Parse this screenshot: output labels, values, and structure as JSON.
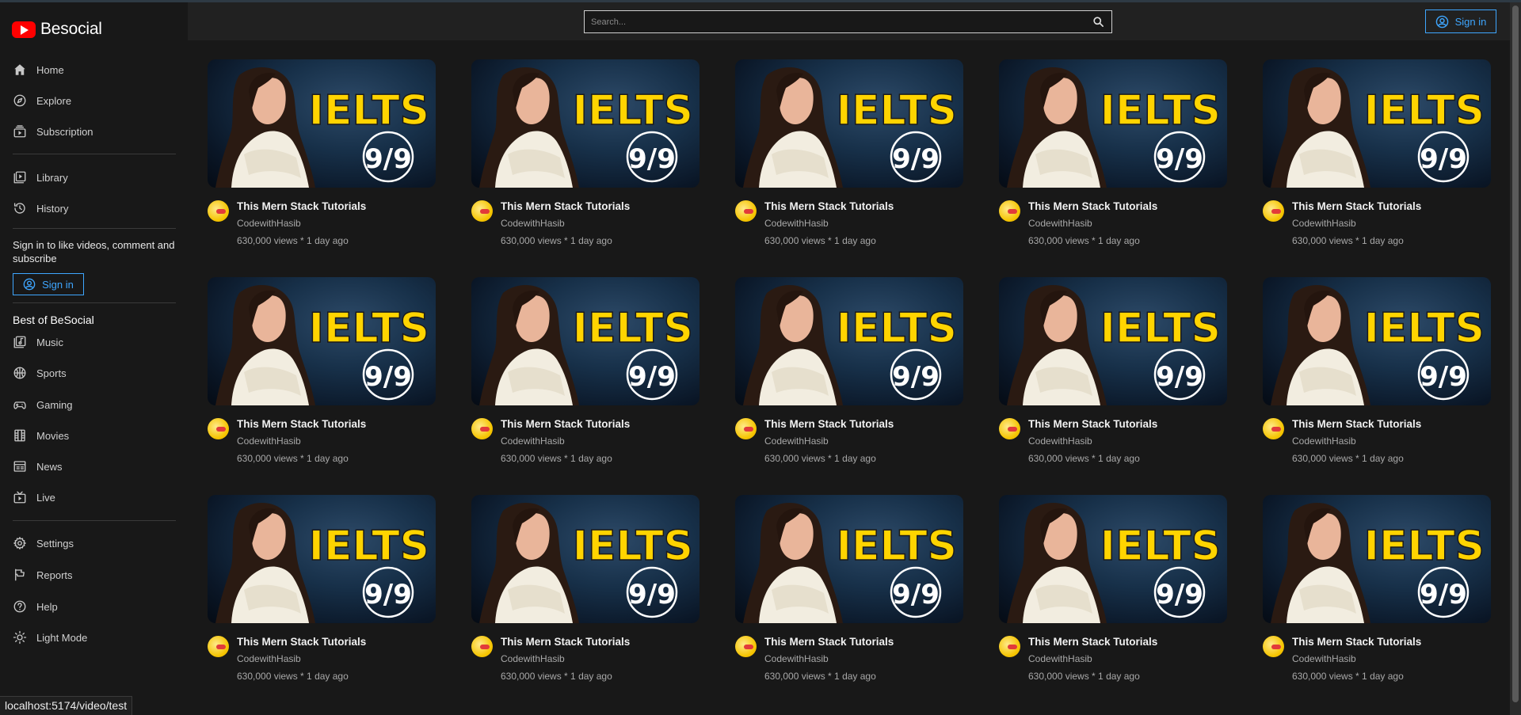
{
  "app": {
    "name": "Besocial"
  },
  "search": {
    "placeholder": "Search..."
  },
  "header": {
    "signin_label": "Sign in"
  },
  "sidebar": {
    "main": [
      {
        "label": "Home",
        "icon": "home-icon"
      },
      {
        "label": "Explore",
        "icon": "compass-icon"
      },
      {
        "label": "Subscription",
        "icon": "subscriptions-icon"
      }
    ],
    "library": [
      {
        "label": "Library",
        "icon": "library-icon"
      },
      {
        "label": "History",
        "icon": "history-icon"
      }
    ],
    "signin_prompt": "Sign in to like videos, comment and subscribe",
    "signin_label": "Sign in",
    "best_title": "Best of BeSocial",
    "best": [
      {
        "label": "Music",
        "icon": "music-icon"
      },
      {
        "label": "Sports",
        "icon": "sports-icon"
      },
      {
        "label": "Gaming",
        "icon": "gaming-icon"
      },
      {
        "label": "Movies",
        "icon": "movies-icon"
      },
      {
        "label": "News",
        "icon": "news-icon"
      },
      {
        "label": "Live",
        "icon": "live-icon"
      }
    ],
    "bottom": [
      {
        "label": "Settings",
        "icon": "gear-icon"
      },
      {
        "label": "Reports",
        "icon": "flag-icon"
      },
      {
        "label": "Help",
        "icon": "help-icon"
      },
      {
        "label": "Light Mode",
        "icon": "sun-icon"
      }
    ]
  },
  "thumbnail": {
    "text_main": "IELTS",
    "text_score": "9/9"
  },
  "videos": [
    {
      "title": "This Mern Stack Tutorials",
      "channel": "CodewithHasib",
      "stats": "630,000 views * 1 day ago"
    },
    {
      "title": "This Mern Stack Tutorials",
      "channel": "CodewithHasib",
      "stats": "630,000 views * 1 day ago"
    },
    {
      "title": "This Mern Stack Tutorials",
      "channel": "CodewithHasib",
      "stats": "630,000 views * 1 day ago"
    },
    {
      "title": "This Mern Stack Tutorials",
      "channel": "CodewithHasib",
      "stats": "630,000 views * 1 day ago"
    },
    {
      "title": "This Mern Stack Tutorials",
      "channel": "CodewithHasib",
      "stats": "630,000 views * 1 day ago"
    },
    {
      "title": "This Mern Stack Tutorials",
      "channel": "CodewithHasib",
      "stats": "630,000 views * 1 day ago"
    },
    {
      "title": "This Mern Stack Tutorials",
      "channel": "CodewithHasib",
      "stats": "630,000 views * 1 day ago"
    },
    {
      "title": "This Mern Stack Tutorials",
      "channel": "CodewithHasib",
      "stats": "630,000 views * 1 day ago"
    },
    {
      "title": "This Mern Stack Tutorials",
      "channel": "CodewithHasib",
      "stats": "630,000 views * 1 day ago"
    },
    {
      "title": "This Mern Stack Tutorials",
      "channel": "CodewithHasib",
      "stats": "630,000 views * 1 day ago"
    },
    {
      "title": "This Mern Stack Tutorials",
      "channel": "CodewithHasib",
      "stats": "630,000 views * 1 day ago"
    },
    {
      "title": "This Mern Stack Tutorials",
      "channel": "CodewithHasib",
      "stats": "630,000 views * 1 day ago"
    },
    {
      "title": "This Mern Stack Tutorials",
      "channel": "CodewithHasib",
      "stats": "630,000 views * 1 day ago"
    },
    {
      "title": "This Mern Stack Tutorials",
      "channel": "CodewithHasib",
      "stats": "630,000 views * 1 day ago"
    },
    {
      "title": "This Mern Stack Tutorials",
      "channel": "CodewithHasib",
      "stats": "630,000 views * 1 day ago"
    }
  ],
  "status_bar": {
    "url": "localhost:5174/video/test"
  },
  "colors": {
    "accent": "#3ea6ff",
    "brand": "#ff0000",
    "background": "#181818",
    "thumb_text": "#ffd400"
  }
}
